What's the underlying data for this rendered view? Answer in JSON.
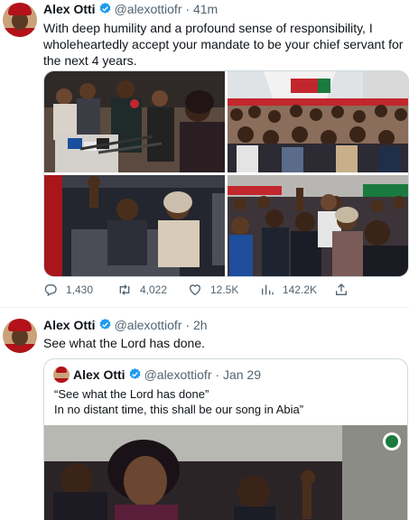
{
  "tweets": [
    {
      "name": "Alex Otti",
      "handle": "@alexottiofr",
      "time": "41m",
      "text": "With deep humility and a profound sense of responsibility, I wholeheartedly accept your mandate to be your chief servant for the next 4 years.",
      "stats": {
        "replies": "1,430",
        "retweets": "4,022",
        "likes": "12.5K",
        "views": "142.2K"
      }
    },
    {
      "name": "Alex Otti",
      "handle": "@alexottiofr",
      "time": "2h",
      "text": "See what the Lord has done.",
      "quoted": {
        "name": "Alex Otti",
        "handle": "@alexottiofr",
        "time": "Jan 29",
        "line1": "“See what the Lord has done”",
        "line2": "In no distant time, this shall be our song in Abia”"
      }
    }
  ],
  "separator": "·",
  "colors": {
    "verified": "#1d9bf0",
    "text": "#0f1419",
    "muted": "#536471",
    "border": "#cfd9de"
  },
  "icons": [
    "verified-badge-icon",
    "reply-icon",
    "retweet-icon",
    "like-icon",
    "views-icon",
    "share-icon"
  ]
}
